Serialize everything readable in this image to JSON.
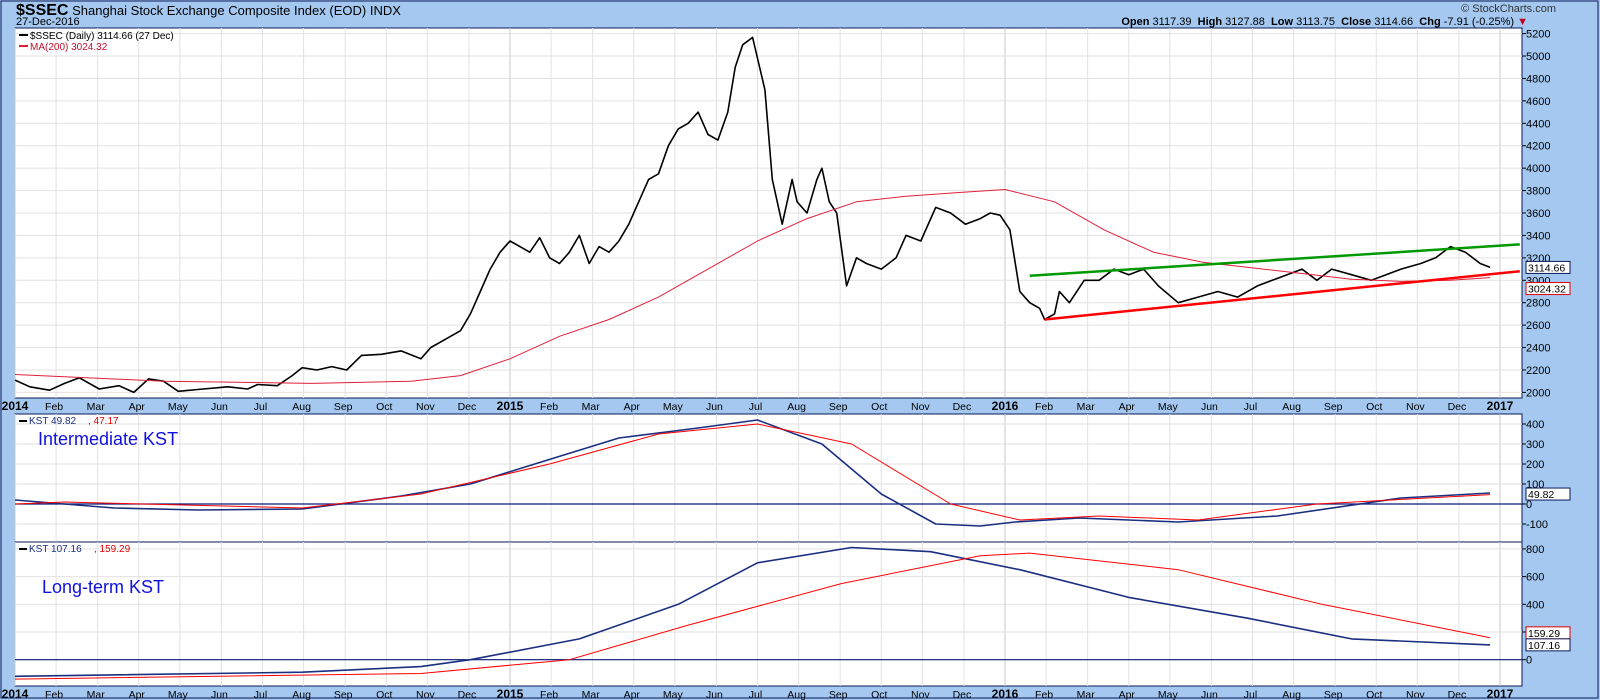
{
  "header": {
    "symbol": "$SSEC",
    "name": "Shanghai Stock Exchange Composite Index (EOD)",
    "exchange": "INDX",
    "date": "27-Dec-2016",
    "copyright": "© StockCharts.com",
    "open_label": "Open",
    "open": "3117.39",
    "high_label": "High",
    "high": "3127.88",
    "low_label": "Low",
    "low": "3113.75",
    "close_label": "Close",
    "close": "3114.66",
    "chg_label": "Chg",
    "chg": "-7.91 (-0.25%)"
  },
  "chart_data": [
    {
      "type": "line",
      "title": "$SSEC Shanghai Stock Exchange Composite Index (EOD)",
      "legend": [
        "$SSEC (Daily) 3114.66 (27 Dec)",
        "MA(200) 3024.32"
      ],
      "ylim": [
        1950,
        5250
      ],
      "yticks": [
        2000,
        2200,
        2400,
        2600,
        2800,
        3000,
        3200,
        3400,
        3600,
        3800,
        4000,
        4200,
        4400,
        4600,
        4800,
        5000,
        5200
      ],
      "last_labels": [
        "3114.66",
        "3024.32"
      ],
      "colors": {
        "price": "#000000",
        "ma": "#e0203a",
        "support": "#ff0000",
        "resistance": "#009900"
      },
      "series": [
        {
          "name": "$SSEC",
          "x": [
            2014.0,
            2014.03,
            2014.07,
            2014.1,
            2014.13,
            2014.17,
            2014.21,
            2014.24,
            2014.27,
            2014.3,
            2014.33,
            2014.38,
            2014.43,
            2014.47,
            2014.49,
            2014.53,
            2014.56,
            2014.58,
            2014.61,
            2014.64,
            2014.67,
            2014.7,
            2014.74,
            2014.78,
            2014.82,
            2014.84,
            2014.86,
            2014.9,
            2014.92,
            2014.94,
            2014.96,
            2014.98,
            2015.0,
            2015.02,
            2015.04,
            2015.06,
            2015.08,
            2015.1,
            2015.12,
            2015.14,
            2015.16,
            2015.18,
            2015.2,
            2015.22,
            2015.24,
            2015.26,
            2015.28,
            2015.3,
            2015.32,
            2015.34,
            2015.36,
            2015.38,
            2015.4,
            2015.42,
            2015.44,
            2015.455,
            2015.47,
            2015.49,
            2015.515,
            2015.53,
            2015.55,
            2015.57,
            2015.58,
            2015.6,
            2015.62,
            2015.63,
            2015.645,
            2015.66,
            2015.68,
            2015.7,
            2015.72,
            2015.75,
            2015.78,
            2015.8,
            2015.83,
            2015.86,
            2015.89,
            2015.92,
            2015.95,
            2015.97,
            2015.99,
            2016.01,
            2016.03,
            2016.05,
            2016.07,
            2016.08,
            2016.1,
            2016.11,
            2016.13,
            2016.16,
            2016.19,
            2016.22,
            2016.25,
            2016.28,
            2016.31,
            2016.35,
            2016.39,
            2016.43,
            2016.47,
            2016.51,
            2016.54,
            2016.57,
            2016.6,
            2016.63,
            2016.66,
            2016.7,
            2016.74,
            2016.77,
            2016.8,
            2016.84,
            2016.87,
            2016.9,
            2016.93,
            2016.96,
            2016.98
          ],
          "y": [
            2110,
            2050,
            2020,
            2080,
            2130,
            2030,
            2060,
            2000,
            2120,
            2100,
            2010,
            2030,
            2050,
            2030,
            2070,
            2060,
            2150,
            2220,
            2200,
            2230,
            2200,
            2330,
            2340,
            2370,
            2300,
            2400,
            2450,
            2550,
            2700,
            2900,
            3100,
            3250,
            3350,
            3300,
            3250,
            3380,
            3200,
            3150,
            3250,
            3400,
            3150,
            3300,
            3250,
            3350,
            3500,
            3700,
            3900,
            3950,
            4200,
            4350,
            4400,
            4500,
            4300,
            4250,
            4500,
            4900,
            5100,
            5166,
            4700,
            3900,
            3500,
            3900,
            3700,
            3600,
            3900,
            4000,
            3700,
            3600,
            2950,
            3200,
            3150,
            3100,
            3200,
            3400,
            3350,
            3650,
            3600,
            3500,
            3550,
            3600,
            3580,
            3450,
            2900,
            2800,
            2750,
            2650,
            2700,
            2900,
            2800,
            3000,
            3000,
            3100,
            3050,
            3100,
            2950,
            2800,
            2850,
            2900,
            2850,
            2950,
            3000,
            3050,
            3100,
            3000,
            3100,
            3050,
            3000,
            3050,
            3100,
            3150,
            3200,
            3300,
            3250,
            3150,
            3115
          ]
        },
        {
          "name": "MA(200)",
          "x": [
            2014.0,
            2014.3,
            2014.6,
            2014.8,
            2014.9,
            2015.0,
            2015.1,
            2015.2,
            2015.3,
            2015.4,
            2015.5,
            2015.6,
            2015.7,
            2015.8,
            2015.9,
            2016.0,
            2016.1,
            2016.2,
            2016.3,
            2016.4,
            2016.5,
            2016.6,
            2016.7,
            2016.8,
            2016.9,
            2016.98
          ],
          "y": [
            2160,
            2100,
            2080,
            2100,
            2150,
            2300,
            2500,
            2650,
            2850,
            3100,
            3350,
            3550,
            3700,
            3750,
            3780,
            3810,
            3700,
            3450,
            3250,
            3160,
            3110,
            3060,
            3010,
            2990,
            3000,
            3024
          ]
        },
        {
          "name": "Resistance trendline",
          "x": [
            2016.05,
            2017.04
          ],
          "y": [
            3040,
            3320
          ]
        },
        {
          "name": "Support trendline",
          "x": [
            2016.08,
            2017.04
          ],
          "y": [
            2650,
            3080
          ]
        }
      ]
    },
    {
      "type": "line",
      "title": "Intermediate KST",
      "legend": [
        "KST 49.82",
        "47.17"
      ],
      "ylim": [
        -190,
        450
      ],
      "yticks": [
        -100,
        0,
        100,
        200,
        300,
        400
      ],
      "last_labels": [
        "49.82"
      ],
      "series": [
        {
          "name": "KST",
          "color": "#1a2f80",
          "x": [
            2014.0,
            2014.2,
            2014.37,
            2014.58,
            2014.78,
            2014.92,
            2015.05,
            2015.22,
            2015.38,
            2015.5,
            2015.63,
            2015.75,
            2015.86,
            2015.95,
            2016.02,
            2016.15,
            2016.35,
            2016.55,
            2016.8,
            2016.98
          ],
          "y": [
            20,
            -20,
            -30,
            -25,
            40,
            100,
            200,
            330,
            380,
            420,
            300,
            50,
            -100,
            -110,
            -90,
            -70,
            -90,
            -60,
            30,
            55
          ]
        },
        {
          "name": "Signal",
          "color": "#ff0000",
          "x": [
            2014.0,
            2014.1,
            2014.58,
            2014.82,
            2015.08,
            2015.3,
            2015.5,
            2015.69,
            2015.89,
            2016.03,
            2016.19,
            2016.39,
            2016.63,
            2016.98
          ],
          "y": [
            0,
            10,
            -20,
            50,
            200,
            350,
            400,
            300,
            0,
            -80,
            -60,
            -80,
            0,
            47
          ]
        }
      ]
    },
    {
      "type": "line",
      "title": "Long-term KST",
      "legend": [
        "KST 107.16",
        "159.29"
      ],
      "ylim": [
        -190,
        850
      ],
      "yticks": [
        0,
        200,
        400,
        600,
        800
      ],
      "last_labels": [
        "159.29",
        "107.16"
      ],
      "series": [
        {
          "name": "KST",
          "color": "#1a2f80",
          "x": [
            2014.0,
            2014.58,
            2014.82,
            2014.92,
            2015.14,
            2015.34,
            2015.5,
            2015.69,
            2015.85,
            2016.03,
            2016.25,
            2016.49,
            2016.7,
            2016.98
          ],
          "y": [
            -120,
            -90,
            -50,
            0,
            150,
            400,
            700,
            810,
            780,
            650,
            450,
            300,
            150,
            107
          ]
        },
        {
          "name": "Signal",
          "color": "#ff0000",
          "x": [
            2014.0,
            2014.82,
            2015.12,
            2015.36,
            2015.67,
            2015.95,
            2016.05,
            2016.35,
            2016.64,
            2016.98
          ],
          "y": [
            -140,
            -100,
            0,
            250,
            550,
            750,
            770,
            650,
            400,
            159
          ]
        }
      ]
    }
  ],
  "x_axis": {
    "ticks": [
      {
        "t": 2014.0,
        "label": "2014",
        "bold": true
      },
      {
        "t": 2014.083,
        "label": "Feb"
      },
      {
        "t": 2014.167,
        "label": "Mar"
      },
      {
        "t": 2014.25,
        "label": "Apr"
      },
      {
        "t": 2014.333,
        "label": "May"
      },
      {
        "t": 2014.417,
        "label": "Jun"
      },
      {
        "t": 2014.5,
        "label": "Jul"
      },
      {
        "t": 2014.583,
        "label": "Aug"
      },
      {
        "t": 2014.667,
        "label": "Sep"
      },
      {
        "t": 2014.75,
        "label": "Oct"
      },
      {
        "t": 2014.833,
        "label": "Nov"
      },
      {
        "t": 2014.917,
        "label": "Dec"
      },
      {
        "t": 2015.0,
        "label": "2015",
        "bold": true
      },
      {
        "t": 2015.083,
        "label": "Feb"
      },
      {
        "t": 2015.167,
        "label": "Mar"
      },
      {
        "t": 2015.25,
        "label": "Apr"
      },
      {
        "t": 2015.333,
        "label": "May"
      },
      {
        "t": 2015.417,
        "label": "Jun"
      },
      {
        "t": 2015.5,
        "label": "Jul"
      },
      {
        "t": 2015.583,
        "label": "Aug"
      },
      {
        "t": 2015.667,
        "label": "Sep"
      },
      {
        "t": 2015.75,
        "label": "Oct"
      },
      {
        "t": 2015.833,
        "label": "Nov"
      },
      {
        "t": 2015.917,
        "label": "Dec"
      },
      {
        "t": 2016.0,
        "label": "2016",
        "bold": true
      },
      {
        "t": 2016.083,
        "label": "Feb"
      },
      {
        "t": 2016.167,
        "label": "Mar"
      },
      {
        "t": 2016.25,
        "label": "Apr"
      },
      {
        "t": 2016.333,
        "label": "May"
      },
      {
        "t": 2016.417,
        "label": "Jun"
      },
      {
        "t": 2016.5,
        "label": "Jul"
      },
      {
        "t": 2016.583,
        "label": "Aug"
      },
      {
        "t": 2016.667,
        "label": "Sep"
      },
      {
        "t": 2016.75,
        "label": "Oct"
      },
      {
        "t": 2016.833,
        "label": "Nov"
      },
      {
        "t": 2016.917,
        "label": "Dec"
      },
      {
        "t": 2017.0,
        "label": "2017",
        "bold": true
      }
    ]
  }
}
